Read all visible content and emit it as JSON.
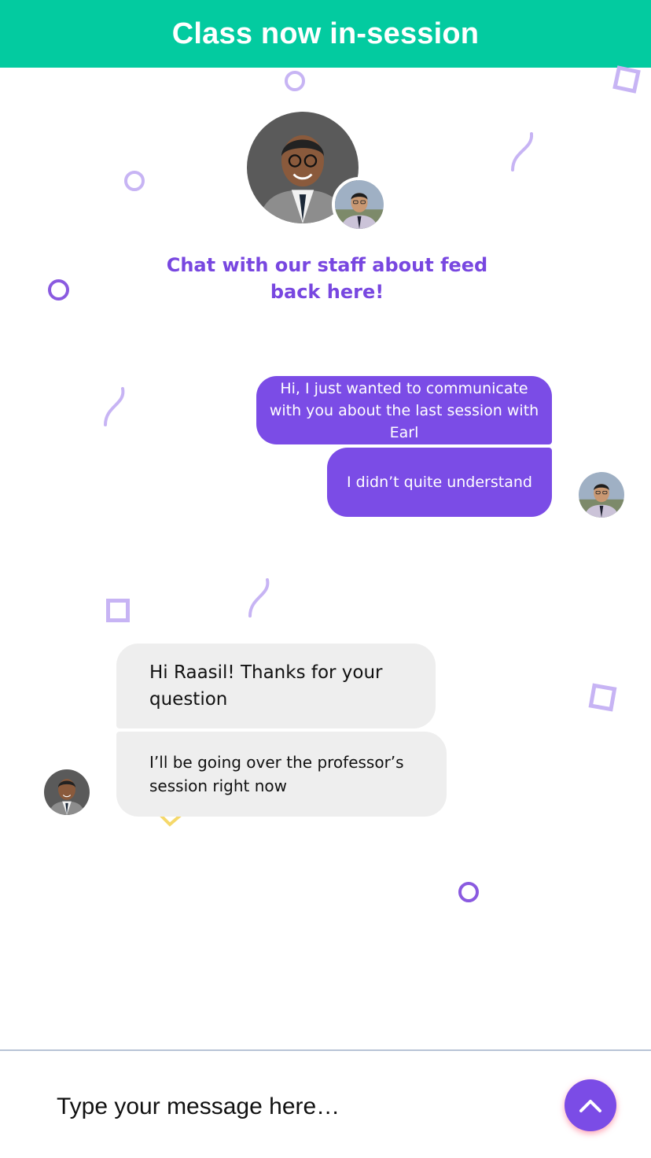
{
  "header": {
    "title": "Class now in-session"
  },
  "hero": {
    "caption": "Chat with our staff about feed back here!"
  },
  "messages": {
    "outgoing": [
      "Hi, I just wanted to communicate with you about the last session with Earl",
      "I didn’t quite understand"
    ],
    "incoming": [
      "Hi Raasil! Thanks for your question",
      "I’ll be going over the professor’s session right now"
    ]
  },
  "composer": {
    "placeholder": "Type your message here…",
    "send_icon": "chevron-up-icon"
  },
  "colors": {
    "header": "#03cba0",
    "accent": "#7b4ce6",
    "incoming_bubble": "#eeeeee"
  }
}
